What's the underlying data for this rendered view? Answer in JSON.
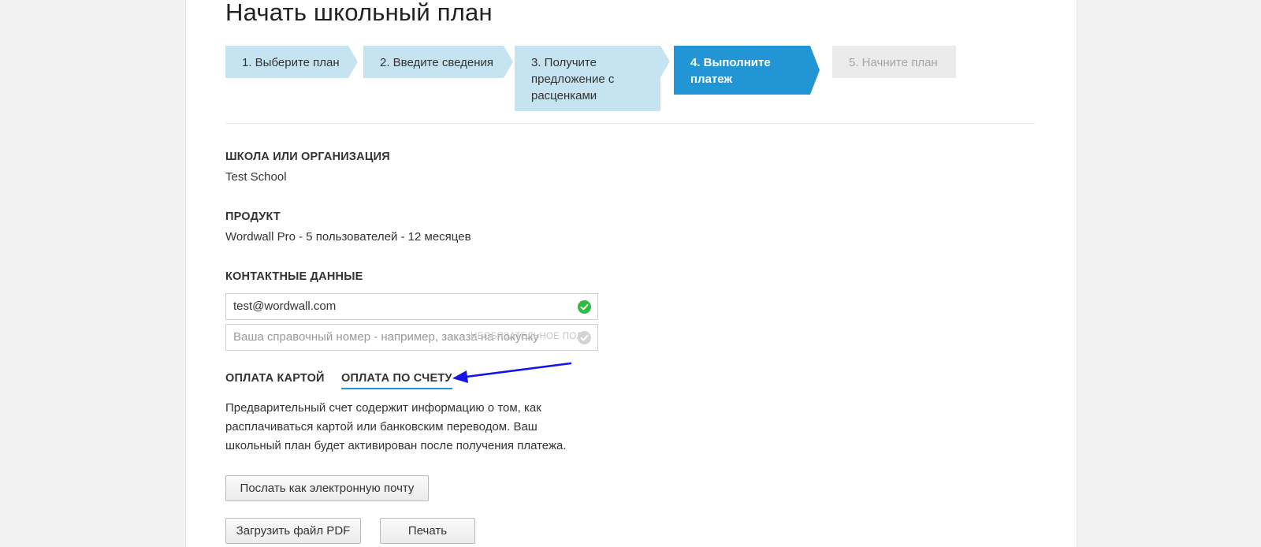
{
  "page": {
    "title": "Начать школьный план"
  },
  "steps": [
    {
      "label": "1. Выберите план",
      "state": "done"
    },
    {
      "label": "2. Введите сведения",
      "state": "done"
    },
    {
      "label": "3. Получите предложение с расценками",
      "state": "done"
    },
    {
      "label": "4. Выполните платеж",
      "state": "active"
    },
    {
      "label": "5. Начните план",
      "state": "todo"
    }
  ],
  "summary": {
    "school_label": "ШКОЛА ИЛИ ОРГАНИЗАЦИЯ",
    "school_value": "Test School",
    "product_label": "ПРОДУКТ",
    "product_value": "Wordwall Pro - 5 пользователей - 12 месяцев",
    "contact_label": "КОНТАКТНЫЕ ДАННЫЕ"
  },
  "contact": {
    "email_value": "test@wordwall.com",
    "email_status_icon": "check-circle-icon",
    "reference_placeholder": "Ваша справочный номер - например, заказа на покупку",
    "reference_hint": "НЕОБЯЗАТЕЛЬНОЕ ПОЛЕ",
    "reference_status_icon": "check-circle-icon"
  },
  "payment_tabs": [
    {
      "label": "ОПЛАТА КАРТОЙ",
      "active": false
    },
    {
      "label": "ОПЛАТА ПО СЧЕТУ",
      "active": true
    }
  ],
  "invoice": {
    "description": "Предварительный счет содержит информацию о том, как расплачиваться картой или банковским переводом. Ваш школьный план будет активирован после получения платежа.",
    "email_button": "Послать как электронную почту",
    "pdf_button": "Загрузить файл PDF",
    "print_button": "Печать"
  },
  "colors": {
    "accent": "#2296d4",
    "step_done": "#c6e3f1",
    "step_todo": "#ebebeb",
    "valid": "#2dbb3f",
    "annotation_arrow": "#1414e6"
  }
}
